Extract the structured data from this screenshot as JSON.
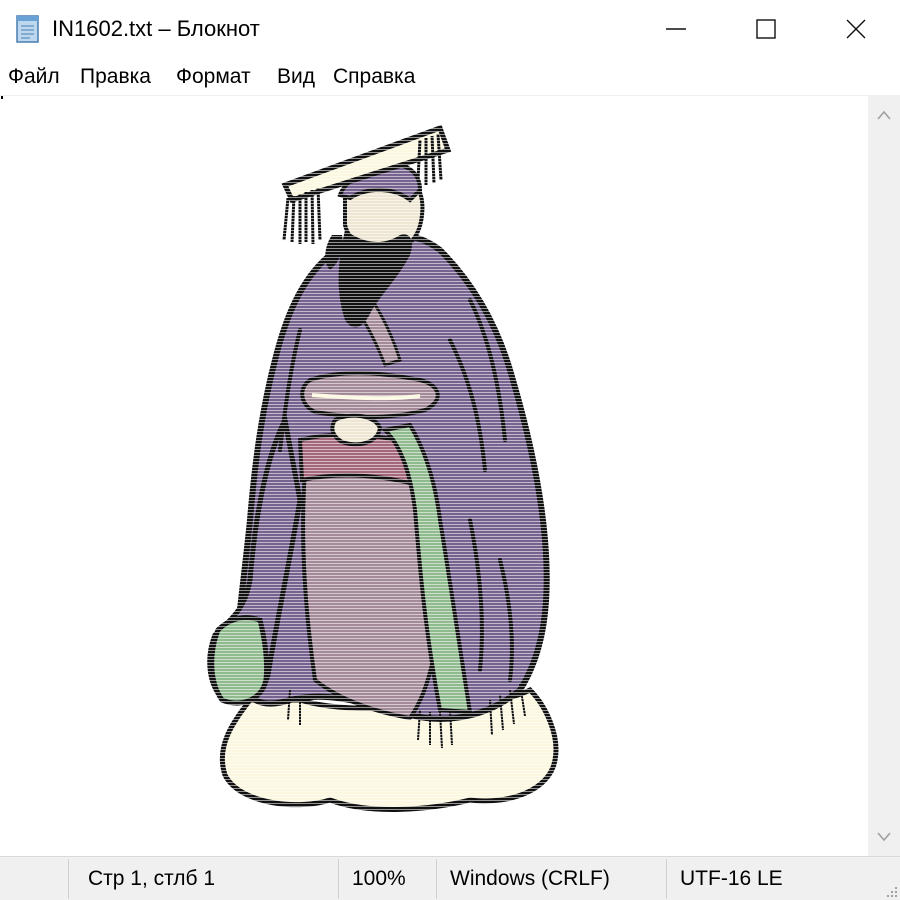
{
  "window": {
    "title": "IN1602.txt – Блокнот",
    "icon": "notepad-icon",
    "controls": [
      "minimize-icon",
      "maximize-icon",
      "close-icon"
    ]
  },
  "menu": {
    "file": "Файл",
    "edit": "Правка",
    "format": "Формат",
    "view": "Вид",
    "help": "Справка"
  },
  "editor": {
    "content_description_icon": "ascii-art-emperor",
    "colors": {
      "robe_purple": "#76628f",
      "inner_robe": "#a48a98",
      "sash": "#a3667a",
      "green_panel": "#8fba8e",
      "cream": "#fcf7df",
      "skin": "#eee6d2",
      "outline": "#111111"
    }
  },
  "status": {
    "position": "Стр 1, стлб 1",
    "zoom": "100%",
    "line_endings": "Windows (CRLF)",
    "encoding": "UTF-16 LE"
  },
  "scrollbar": {
    "up_icon": "chevron-up-icon",
    "down_icon": "chevron-down-icon"
  }
}
